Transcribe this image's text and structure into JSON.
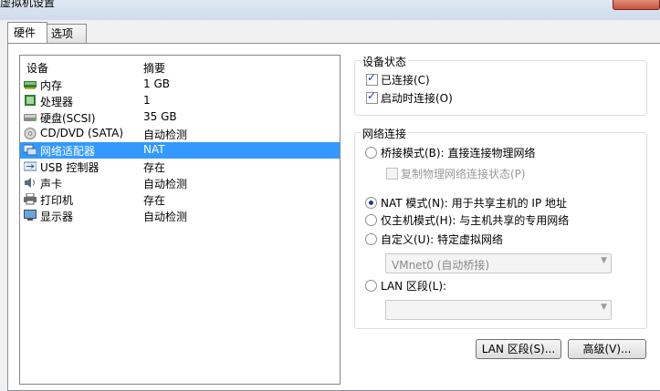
{
  "window": {
    "title": "虚拟机设置"
  },
  "tabs": [
    {
      "label": "硬件",
      "active": true
    },
    {
      "label": "选项",
      "active": false
    }
  ],
  "devices": {
    "header": {
      "device": "设备",
      "summary": "摘要"
    },
    "rows": [
      {
        "name": "内存",
        "summary": "1 GB",
        "icon": "memory-icon",
        "selected": false
      },
      {
        "name": "处理器",
        "summary": "1",
        "icon": "processor-icon",
        "selected": false
      },
      {
        "name": "硬盘(SCSI)",
        "summary": "35 GB",
        "icon": "harddisk-icon",
        "selected": false
      },
      {
        "name": "CD/DVD (SATA)",
        "summary": "自动检测",
        "icon": "cdrom-icon",
        "selected": false
      },
      {
        "name": "网络适配器",
        "summary": "NAT",
        "icon": "network-adapter-icon",
        "selected": true
      },
      {
        "name": "USB 控制器",
        "summary": "存在",
        "icon": "usb-icon",
        "selected": false
      },
      {
        "name": "声卡",
        "summary": "自动检测",
        "icon": "sound-icon",
        "selected": false
      },
      {
        "name": "打印机",
        "summary": "存在",
        "icon": "printer-icon",
        "selected": false
      },
      {
        "name": "显示器",
        "summary": "自动检测",
        "icon": "display-icon",
        "selected": false
      }
    ]
  },
  "device_status": {
    "legend": "设备状态",
    "connected": {
      "label": "已连接(C)",
      "checked": true
    },
    "connect_at_power_on": {
      "label": "启动时连接(O)",
      "checked": true
    }
  },
  "network": {
    "legend": "网络连接",
    "bridged": {
      "label": "桥接模式(B): 直接连接物理网络",
      "checked": false
    },
    "replicate": {
      "label": "复制物理网络连接状态(P)",
      "checked": false,
      "disabled": true
    },
    "nat": {
      "label": "NAT 模式(N): 用于共享主机的 IP 地址",
      "checked": true
    },
    "host_only": {
      "label": "仅主机模式(H): 与主机共享的专用网络",
      "checked": false
    },
    "custom": {
      "label": "自定义(U): 特定虚拟网络",
      "checked": false
    },
    "custom_select": {
      "value": "VMnet0 (自动桥接)"
    },
    "lan": {
      "label": "LAN 区段(L):",
      "checked": false
    },
    "lan_select": {
      "value": ""
    }
  },
  "buttons": {
    "lan_segments": "LAN 区段(S)...",
    "advanced": "高级(V)..."
  },
  "colors": {
    "selection": "#3399ff",
    "radio_dot": "#1d3a8f",
    "border": "#d5dfe5"
  }
}
